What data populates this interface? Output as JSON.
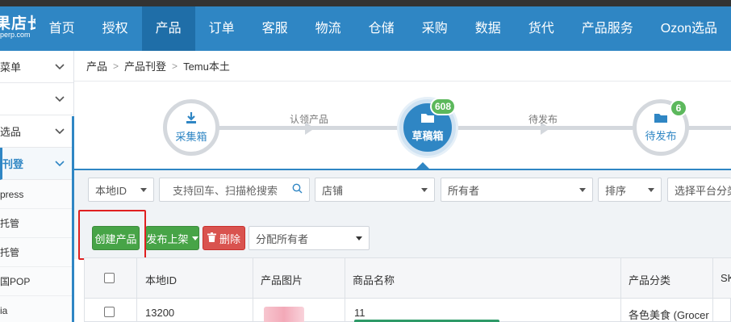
{
  "logo": {
    "line1": "果店长",
    "line2": "perp.com"
  },
  "nav": {
    "items": [
      "首页",
      "授权",
      "产品",
      "订单",
      "客服",
      "物流",
      "仓储",
      "采购",
      "数据",
      "货代",
      "产品服务",
      "Ozon选品"
    ],
    "active_index": 2
  },
  "sidebar": {
    "items": [
      {
        "label": "菜单",
        "type": "group"
      },
      {
        "label": "",
        "type": "group"
      },
      {
        "label": "选品",
        "type": "group"
      },
      {
        "label": "刊登",
        "type": "group",
        "active": true
      },
      {
        "label": "press",
        "type": "sub"
      },
      {
        "label": "托管",
        "type": "sub"
      },
      {
        "label": "托管",
        "type": "sub"
      },
      {
        "label": "国POP",
        "type": "sub"
      },
      {
        "label": "ia",
        "type": "sub"
      }
    ]
  },
  "breadcrumb": {
    "items": [
      "产品",
      "产品刊登",
      "Temu本土"
    ]
  },
  "steps": {
    "collect_box": {
      "label": "采集箱"
    },
    "claim_text": "认领产品",
    "draft_box": {
      "label": "草稿箱",
      "badge": "608"
    },
    "publish_text": "待发布",
    "pending_publish": {
      "label": "待发布",
      "badge": "6"
    }
  },
  "filters": {
    "local_id": "本地ID",
    "search_placeholder": "支持回车、扫描枪搜索",
    "shop": "店铺",
    "owner": "所有者",
    "sort": "排序",
    "platform_category": "选择平台分类"
  },
  "actions": {
    "create_product": "创建产品",
    "publish": "发布上架",
    "delete": "删除",
    "assign_owner": "分配所有者"
  },
  "table": {
    "headers": {
      "local_id": "本地ID",
      "image": "产品图片",
      "name": "商品名称",
      "category": "产品分类",
      "sku": "SK"
    },
    "rows": [
      {
        "local_id": "13200",
        "name": "11",
        "category": "各色美食 (Grocer"
      }
    ]
  },
  "colors": {
    "brand": "#2f86c4",
    "green": "#47a447",
    "red": "#d9534f",
    "highlight": "#e02020"
  }
}
